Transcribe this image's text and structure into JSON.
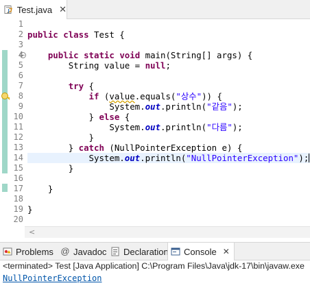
{
  "editor_tab": {
    "label": "Test.java",
    "close": "✕"
  },
  "code_lines": [
    {
      "num": "1"
    },
    {
      "num": "2"
    },
    {
      "num": "3"
    },
    {
      "num": "4"
    },
    {
      "num": "5"
    },
    {
      "num": "6"
    },
    {
      "num": "7"
    },
    {
      "num": "8"
    },
    {
      "num": "9"
    },
    {
      "num": "10"
    },
    {
      "num": "11"
    },
    {
      "num": "12"
    },
    {
      "num": "13"
    },
    {
      "num": "14"
    },
    {
      "num": "15"
    },
    {
      "num": "16"
    },
    {
      "num": "17"
    },
    {
      "num": "18"
    },
    {
      "num": "19"
    },
    {
      "num": "20"
    }
  ],
  "code": {
    "l2": {
      "kw1": "public",
      "kw2": "class",
      "rest": " Test {"
    },
    "l4": {
      "kw1": "public",
      "kw2": "static",
      "kw3": "void",
      "rest": " main(String[] args) {"
    },
    "l5": {
      "pre": "String value = ",
      "kw": "null",
      "post": ";"
    },
    "l7": {
      "kw": "try",
      "post": " {"
    },
    "l8": {
      "kw": "if",
      "pre": " (",
      "warn": "value",
      "mid": ".equals(",
      "str": "\"상수\"",
      "post": ")) {"
    },
    "l9": {
      "pre": "System.",
      "st": "out",
      "mid": ".println(",
      "str": "\"같음\"",
      "post": ");"
    },
    "l10": {
      "pre": "} ",
      "kw": "else",
      "post": " {"
    },
    "l11": {
      "pre": "System.",
      "st": "out",
      "mid": ".println(",
      "str": "\"다름\"",
      "post": ");"
    },
    "l12": {
      "text": "}"
    },
    "l13": {
      "pre": "} ",
      "kw": "catch",
      "post": " (NullPointerException e) {"
    },
    "l14": {
      "pre": "System.",
      "st": "out",
      "mid": ".println(",
      "str": "\"NullPointerException\"",
      "post": ");"
    },
    "l15": {
      "text": "}"
    },
    "l17": {
      "text": "}"
    },
    "l19": {
      "text": "}"
    }
  },
  "views": {
    "tabs": [
      {
        "label": "Problems"
      },
      {
        "label": "Javadoc"
      },
      {
        "label": "Declaration"
      },
      {
        "label": "Console",
        "close": "✕"
      }
    ]
  },
  "console": {
    "title": "<terminated> Test [Java Application] C:\\Program Files\\Java\\jdk-17\\bin\\javaw.exe",
    "output": "NullPointerException"
  },
  "colors": {
    "keyword": "#7f0055",
    "string": "#2a00ff",
    "static_field": "#0000c0",
    "current_line": "#e8f2fe"
  }
}
